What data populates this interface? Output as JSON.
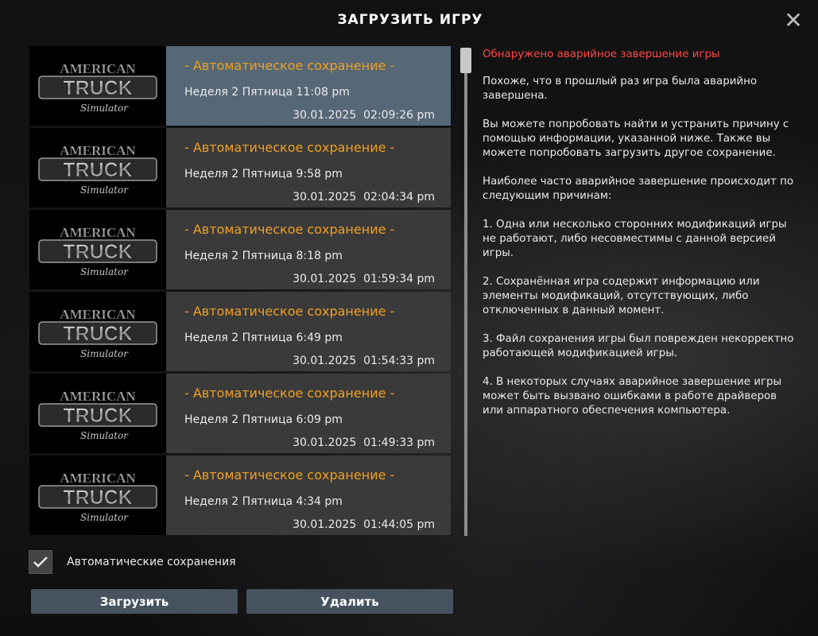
{
  "dialog": {
    "title": "ЗАГРУЗИТЬ ИГРУ",
    "close_icon": "close-icon"
  },
  "saves": [
    {
      "name": "- Автоматическое сохранение -",
      "day": "Неделя 2  Пятница 11:08 pm",
      "date": "30.01.2025  02:09:26 pm",
      "selected": true,
      "thumb_logo": {
        "top": "AMERICAN",
        "mid": "TRUCK",
        "bottom": "Simulator"
      }
    },
    {
      "name": "- Автоматическое сохранение -",
      "day": "Неделя 2  Пятница 9:58 pm",
      "date": "30.01.2025  02:04:34 pm",
      "selected": false,
      "thumb_logo": {
        "top": "AMERICAN",
        "mid": "TRUCK",
        "bottom": "Simulator"
      }
    },
    {
      "name": "- Автоматическое сохранение -",
      "day": "Неделя 2  Пятница 8:18 pm",
      "date": "30.01.2025  01:59:34 pm",
      "selected": false,
      "thumb_logo": {
        "top": "AMERICAN",
        "mid": "TRUCK",
        "bottom": "Simulator"
      }
    },
    {
      "name": "- Автоматическое сохранение -",
      "day": "Неделя 2  Пятница 6:49 pm",
      "date": "30.01.2025  01:54:33 pm",
      "selected": false,
      "thumb_logo": {
        "top": "AMERICAN",
        "mid": "TRUCK",
        "bottom": "Simulator"
      }
    },
    {
      "name": "- Автоматическое сохранение -",
      "day": "Неделя 2  Пятница 6:09 pm",
      "date": "30.01.2025  01:49:33 pm",
      "selected": false,
      "thumb_logo": {
        "top": "AMERICAN",
        "mid": "TRUCK",
        "bottom": "Simulator"
      }
    },
    {
      "name": "- Автоматическое сохранение -",
      "day": "Неделя 2  Пятница 4:34 pm",
      "date": "30.01.2025  01:44:05 pm",
      "selected": false,
      "thumb_logo": {
        "top": "AMERICAN",
        "mid": "TRUCK",
        "bottom": "Simulator"
      }
    }
  ],
  "details": {
    "error": "Обнаружено аварийное завершение игры",
    "paragraphs": [
      "Похоже, что в прошлый раз игра была аварийно завершена.",
      "Вы можете попробовать найти и устранить причину с помощью информации, указанной ниже. Также вы можете попробовать загрузить другое сохранение.",
      "Наиболее часто аварийное завершение происходит по следующим причинам:",
      "1. Одна или несколько сторонних модификаций игры не работают, либо несовместимы с данной версией игры.",
      "2. Сохранённая игра содержит информацию или элементы модификаций, отсутствующих, либо отключенных в данный момент.",
      "3. Файл сохранения игры был поврежден некорректно работающей модификацией игры.",
      "4. В некоторых случаях аварийное завершение игры может быть вызвано ошибками в работе драйверов или аппаратного обеспечения компьютера."
    ]
  },
  "autosave_filter": {
    "label": "Автоматические сохранения",
    "checked": true,
    "icon": "checkmark-icon"
  },
  "buttons": {
    "load": "Загрузить",
    "delete": "Удалить"
  },
  "colors": {
    "accent_orange": "#f0a020",
    "error_red": "#ff4646",
    "selected_row": "#566776",
    "row": "#3a3a3b",
    "button": "#46525e"
  }
}
